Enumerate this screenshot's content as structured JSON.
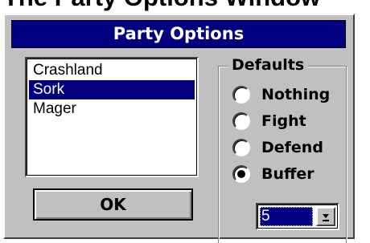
{
  "page": {
    "heading": "The Party Options Window"
  },
  "dialog": {
    "title": "Party Options",
    "party_list": {
      "items": [
        "Crashland",
        "Sork",
        "Mager"
      ],
      "selected": "Sork"
    },
    "ok_label": "OK",
    "defaults": {
      "label": "Defaults",
      "options": [
        "Nothing",
        "Fight",
        "Defend",
        "Buffer"
      ],
      "selected": "Buffer",
      "buffer_value": "5"
    }
  },
  "colors": {
    "face": "#c0c0c0",
    "title_bar": "#000080",
    "selection": "#000080"
  },
  "icons": {
    "dropdown": "dropdown-arrow-icon"
  }
}
